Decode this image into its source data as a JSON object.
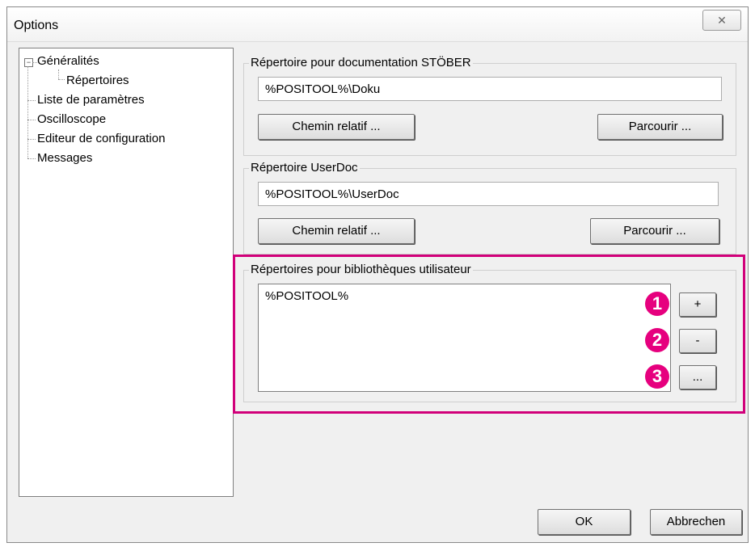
{
  "window": {
    "title": "Options",
    "close_glyph": "✕"
  },
  "tree": {
    "items": [
      {
        "label": "Généralités",
        "toggle": "−"
      },
      {
        "label": "Répertoires"
      },
      {
        "label": "Liste de paramètres"
      },
      {
        "label": "Oscilloscope"
      },
      {
        "label": "Editeur de configuration"
      },
      {
        "label": "Messages"
      }
    ]
  },
  "doc_group": {
    "legend": "Répertoire pour documentation STÖBER",
    "path": "%POSITOOL%\\Doku",
    "relative_button": "Chemin relatif ...",
    "browse_button": "Parcourir ..."
  },
  "userdoc_group": {
    "legend": "Répertoire UserDoc",
    "path": "%POSITOOL%\\UserDoc",
    "relative_button": "Chemin relatif ...",
    "browse_button": "Parcourir ..."
  },
  "library_group": {
    "legend": "Répertoires pour bibliothèques utilisateur",
    "entries": [
      "%POSITOOL%"
    ],
    "add_button": "+",
    "remove_button": "-",
    "edit_button": "...",
    "markers": [
      "1",
      "2",
      "3"
    ]
  },
  "footer": {
    "ok_button": "OK",
    "cancel_button": "Abbrechen"
  },
  "colors": {
    "highlight": "#d1007a",
    "marker": "#e6007e"
  }
}
